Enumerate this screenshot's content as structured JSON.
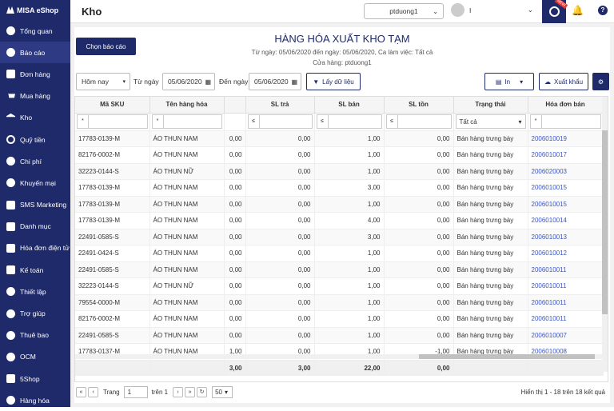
{
  "app": {
    "brand": "MISA eShop"
  },
  "sidebar": {
    "items": [
      {
        "label": "Tổng quan",
        "icon": "dashboard-icon"
      },
      {
        "label": "Báo cáo",
        "icon": "report-icon"
      },
      {
        "label": "Đơn hàng",
        "icon": "order-icon"
      },
      {
        "label": "Mua hàng",
        "icon": "cart-icon"
      },
      {
        "label": "Kho",
        "icon": "warehouse-icon"
      },
      {
        "label": "Quỹ tiền",
        "icon": "cash-icon"
      },
      {
        "label": "Chi phí",
        "icon": "expense-icon"
      },
      {
        "label": "Khuyến mại",
        "icon": "promotion-icon"
      },
      {
        "label": "SMS Marketing",
        "icon": "sms-icon"
      },
      {
        "label": "Danh mục",
        "icon": "catalog-icon"
      },
      {
        "label": "Hóa đơn điện tử",
        "icon": "einvoice-icon"
      },
      {
        "label": "Kế toán",
        "icon": "accounting-icon"
      },
      {
        "label": "Thiết lập",
        "icon": "settings-icon"
      },
      {
        "label": "Trợ giúp",
        "icon": "help-icon"
      },
      {
        "label": "Thuê bao",
        "icon": "subscription-icon"
      },
      {
        "label": "OCM",
        "icon": "ocm-icon"
      },
      {
        "label": "5Shop",
        "icon": "shop-icon"
      },
      {
        "label": "Hàng hóa",
        "icon": "goods-icon"
      }
    ]
  },
  "header": {
    "title": "Kho",
    "branch": "ptduong1",
    "user": "I",
    "new_badge": "NEW"
  },
  "report": {
    "choose_label": "Chọn báo cáo",
    "title": "HÀNG HÓA XUẤT KHO TẠM",
    "subtitle1": "Từ ngày: 05/06/2020 đến ngày: 05/06/2020, Ca làm việc: Tất cả",
    "subtitle2": "Cửa hàng: ptduong1"
  },
  "filters": {
    "period": "Hôm nay",
    "from_label": "Từ ngày",
    "from_date": "05/06/2020",
    "to_label": "Đến ngày",
    "to_date": "05/06/2020",
    "fetch_label": "Lấy dữ liệu",
    "print_label": "In",
    "export_label": "Xuất khẩu"
  },
  "table": {
    "columns": [
      "Mã SKU",
      "Tên hàng hóa",
      "",
      "SL trả",
      "SL bán",
      "SL tồn",
      "Trạng thái",
      "Hóa đơn bán"
    ],
    "filter_ops": [
      "*",
      "*",
      "",
      "≤",
      "≤",
      "≤",
      "",
      "*"
    ],
    "status_filter": "Tất cả",
    "rows": [
      [
        "17783-0139-M",
        "ÁO THUN NAM",
        "0,00",
        "0,00",
        "1,00",
        "0,00",
        "Bán hàng trưng bày",
        "2006010019"
      ],
      [
        "82176-0002-M",
        "ÁO THUN NAM",
        "0,00",
        "0,00",
        "1,00",
        "0,00",
        "Bán hàng trưng bày",
        "2006010017"
      ],
      [
        "32223-0144-S",
        "ÁO THUN NỮ",
        "0,00",
        "0,00",
        "1,00",
        "0,00",
        "Bán hàng trưng bày",
        "2006020003"
      ],
      [
        "17783-0139-M",
        "ÁO THUN NAM",
        "0,00",
        "0,00",
        "3,00",
        "0,00",
        "Bán hàng trưng bày",
        "2006010015"
      ],
      [
        "17783-0139-M",
        "ÁO THUN NAM",
        "0,00",
        "0,00",
        "1,00",
        "0,00",
        "Bán hàng trưng bày",
        "2006010015"
      ],
      [
        "17783-0139-M",
        "ÁO THUN NAM",
        "0,00",
        "0,00",
        "4,00",
        "0,00",
        "Bán hàng trưng bày",
        "2006010014"
      ],
      [
        "22491-0585-S",
        "ÁO THUN NAM",
        "0,00",
        "0,00",
        "3,00",
        "0,00",
        "Bán hàng trưng bày",
        "2006010013"
      ],
      [
        "22491-0424-S",
        "ÁO THUN NAM",
        "0,00",
        "0,00",
        "1,00",
        "0,00",
        "Bán hàng trưng bày",
        "2006010012"
      ],
      [
        "22491-0585-S",
        "ÁO THUN NAM",
        "0,00",
        "0,00",
        "1,00",
        "0,00",
        "Bán hàng trưng bày",
        "2006010011"
      ],
      [
        "32223-0144-S",
        "ÁO THUN NỮ",
        "0,00",
        "0,00",
        "1,00",
        "0,00",
        "Bán hàng trưng bày",
        "2006010011"
      ],
      [
        "79554-0000-M",
        "ÁO THUN NAM",
        "0,00",
        "0,00",
        "1,00",
        "0,00",
        "Bán hàng trưng bày",
        "2006010011"
      ],
      [
        "82176-0002-M",
        "ÁO THUN NAM",
        "0,00",
        "0,00",
        "1,00",
        "0,00",
        "Bán hàng trưng bày",
        "2006010011"
      ],
      [
        "22491-0585-S",
        "ÁO THUN NAM",
        "0,00",
        "0,00",
        "1,00",
        "0,00",
        "Bán hàng trưng bày",
        "2006010007"
      ],
      [
        "17783-0137-M",
        "ÁO THUN NAM",
        "1,00",
        "0,00",
        "1,00",
        "-1,00",
        "Bán hàng trưng bày",
        "2006010008"
      ]
    ],
    "totals": [
      "",
      "",
      "3,00",
      "3,00",
      "22,00",
      "0,00",
      "",
      ""
    ]
  },
  "pager": {
    "page_label": "Trang",
    "page": "1",
    "of_label": "trên 1",
    "page_size": "50",
    "info": "Hiển thị 1 - 18 trên 18 kết quả"
  }
}
